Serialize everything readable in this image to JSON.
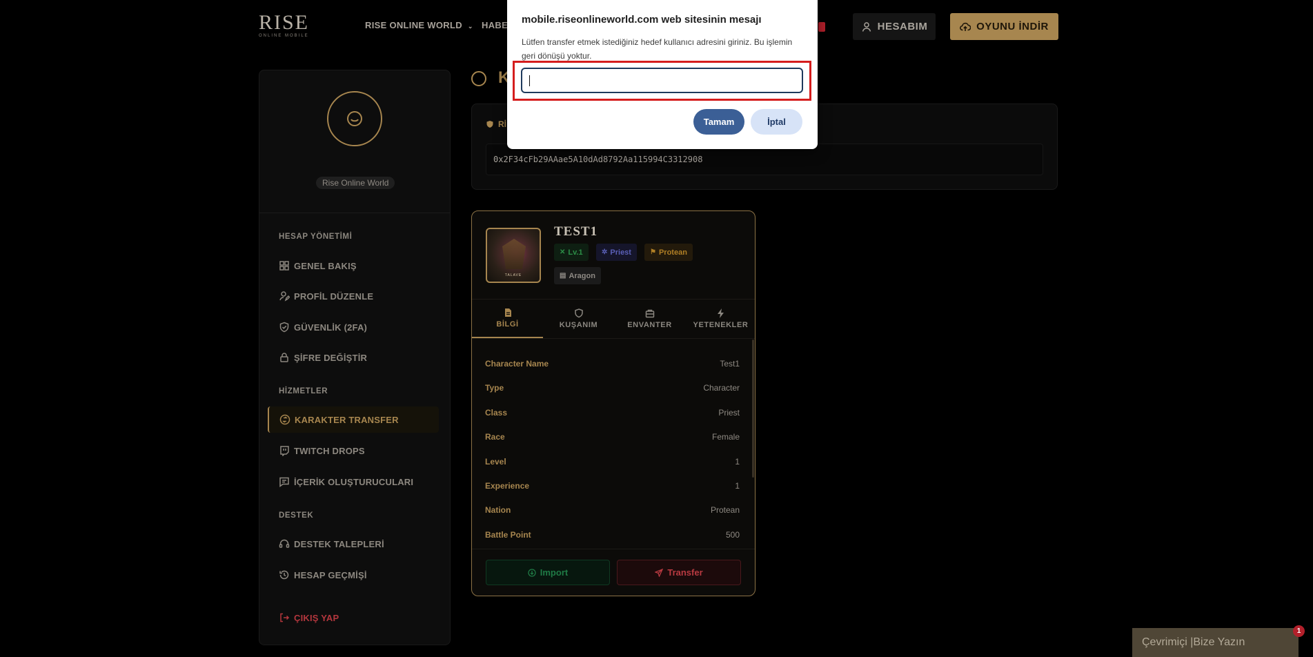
{
  "nav": {
    "logo_text": "RISE",
    "logo_sub": "ONLINE   MOBILE",
    "menu": [
      "RISE ONLINE WORLD",
      "HABE"
    ],
    "account_label": "HESABIM",
    "download_label": "OYUNU İNDİR"
  },
  "sidebar": {
    "profile_name": "Rise Online World",
    "sections": {
      "account": "HESAP YÖNETİMİ",
      "services": "HİZMETLER",
      "support": "DESTEK"
    },
    "items": {
      "overview": "GENEL BAKIŞ",
      "edit_profile": "PROFİL DÜZENLE",
      "security": "GÜVENLİK (2FA)",
      "change_password": "ŞİFRE DEĞİŞTİR",
      "character_transfer": "KARAKTER TRANSFER",
      "twitch_drops": "TWITCH DROPS",
      "content_creators": "İÇERİK OLUŞTURUCULARI",
      "support_tickets": "DESTEK TALEPLERİ",
      "account_history": "HESAP GEÇMİŞİ",
      "logout": "ÇIKIŞ YAP"
    },
    "icons": [
      "grid-icon",
      "user-edit-icon",
      "shield-check-icon",
      "lock-icon",
      "transfer-icon",
      "twitch-icon",
      "chat-icon",
      "headset-icon",
      "history-icon",
      "logout-icon"
    ]
  },
  "main": {
    "title": "K",
    "wallet_label": "Rİ",
    "wallet_address": "0x2F34cFb29AAae5A10dAd8792Aa115994C3312908"
  },
  "character": {
    "name": "TEST1",
    "portrait_text": "TALAVE",
    "level_badge": "Lv.1",
    "class_badge": "Priest",
    "nation_badge": "Protean",
    "server_badge": "Aragon",
    "tabs": [
      "BİLGİ",
      "KUŞANIM",
      "ENVANTER",
      "YETENEKLER"
    ],
    "active_tab": "BİLGİ",
    "info": [
      {
        "key": "Character Name",
        "value": "Test1"
      },
      {
        "key": "Type",
        "value": "Character"
      },
      {
        "key": "Class",
        "value": "Priest"
      },
      {
        "key": "Race",
        "value": "Female"
      },
      {
        "key": "Level",
        "value": "1"
      },
      {
        "key": "Experience",
        "value": "1"
      },
      {
        "key": "Nation",
        "value": "Protean"
      },
      {
        "key": "Battle Point",
        "value": "500"
      }
    ],
    "import_label": "Import",
    "transfer_label": "Transfer"
  },
  "chat": {
    "label": "Çevrimiçi |Bize Yazın",
    "badge": "1"
  },
  "dialog": {
    "title": "mobile.riseonlineworld.com web sitesinin mesajı",
    "message": "Lütfen transfer etmek istediğiniz hedef kullanıcı adresini giriniz. Bu işlemin geri dönüşü yoktur.",
    "input_value": "",
    "ok_label": "Tamam",
    "cancel_label": "İptal"
  },
  "colors": {
    "accent_gold": "#a7864f",
    "background": "#000000",
    "danger": "#b83a41",
    "success": "#1f7a45",
    "dialog_primary": "#3b5f96",
    "highlight_red": "#d51d1d"
  }
}
